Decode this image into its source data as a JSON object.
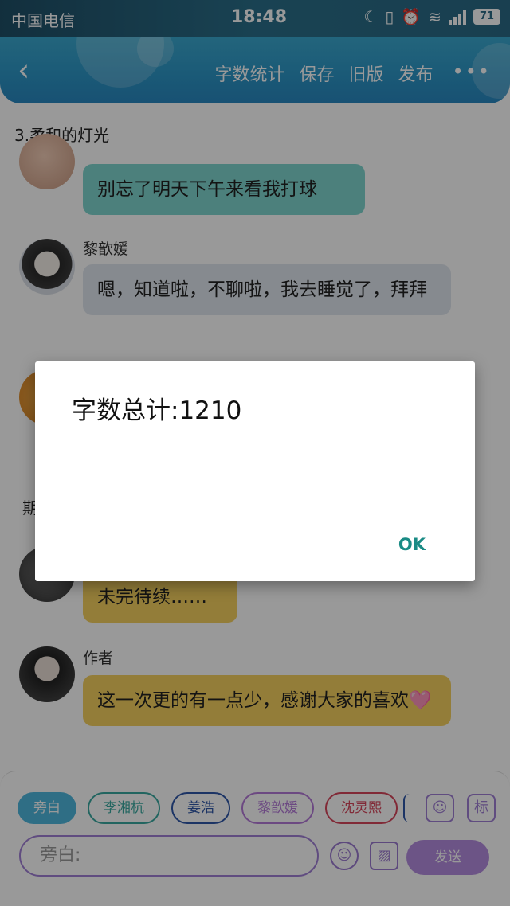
{
  "status_bar": {
    "carrier": "中国电信",
    "time": "18:48",
    "battery": "71"
  },
  "toolbar": {
    "actions": [
      "字数统计",
      "保存",
      "旧版",
      "发布"
    ],
    "more_label": "•••"
  },
  "content": {
    "chapter_title": "3.柔和的灯光",
    "messages": [
      {
        "name": "",
        "text": "别忘了明天下午来看我打球",
        "bubble_color": "#7fd6cf"
      },
      {
        "name": "黎歆媛",
        "text": "嗯，知道啦，不聊啦，我去睡觉了，拜拜",
        "bubble_color": "#dfe6ee"
      },
      {
        "name": "",
        "text": "未完待续……",
        "bubble_color": "#f6d160"
      },
      {
        "name": "作者",
        "text": "这一次更的有一点少，感谢大家的喜欢🩷",
        "bubble_color": "#f6d160"
      }
    ],
    "partial_text_left": "期"
  },
  "bottom": {
    "chips": [
      {
        "label": "旁白",
        "color": "#4fb7de"
      },
      {
        "label": "李湘杭",
        "color": "#3aa9a0"
      },
      {
        "label": "姜浩",
        "color": "#2f57a8"
      },
      {
        "label": "黎歆媛",
        "color": "#b57ad9"
      },
      {
        "label": "沈灵熙",
        "color": "#d7475d"
      }
    ],
    "input_placeholder": "旁白:",
    "send_label": "发送",
    "tag_button_label": "标"
  },
  "dialog": {
    "message": "字数总计:1210",
    "ok_label": "OK"
  },
  "colors": {
    "toolbar_gradient_start": "#3ba9d0",
    "toolbar_gradient_end": "#2987c0",
    "accent_purple": "#a07fd6",
    "dialog_ok": "#1a8b85"
  }
}
